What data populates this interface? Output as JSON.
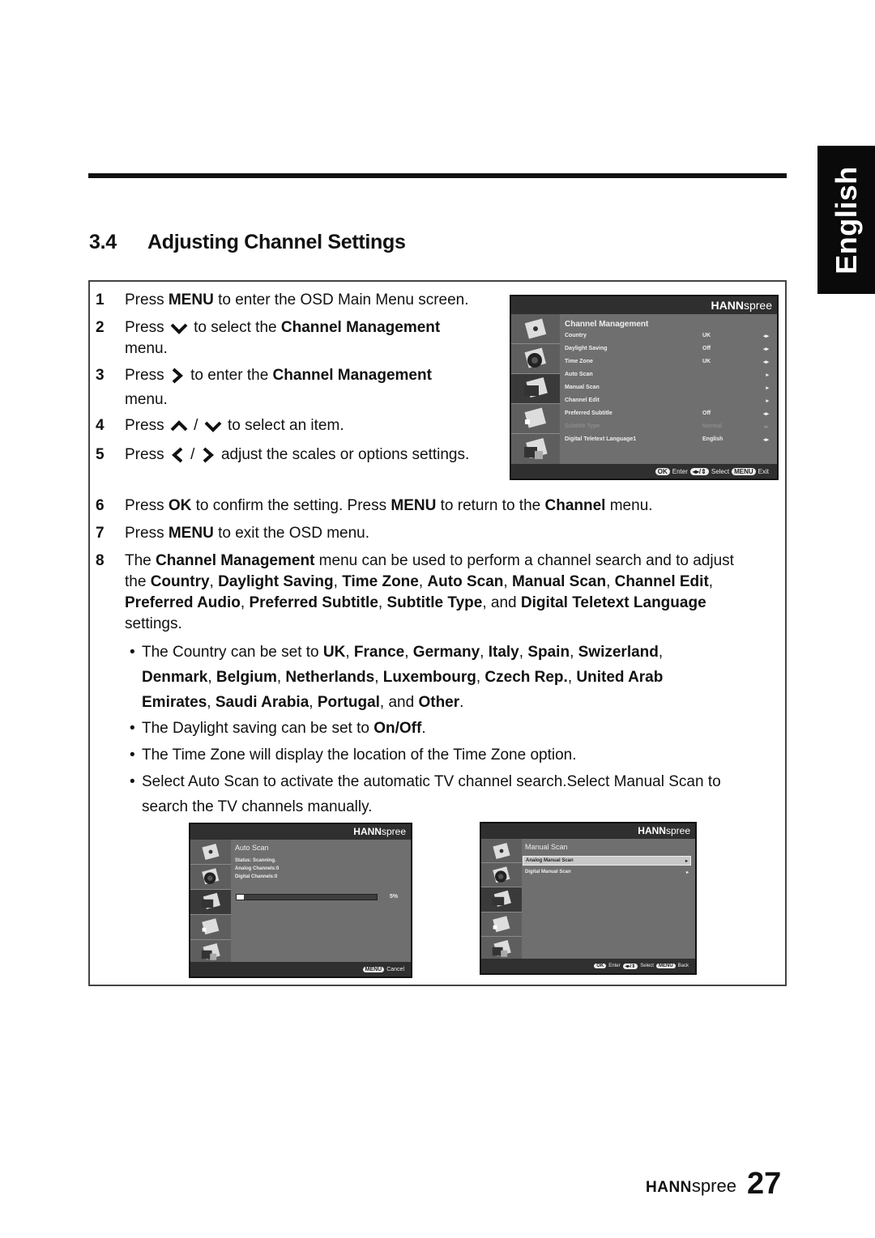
{
  "side_tab": {
    "label": "English"
  },
  "section": {
    "number": "3.4",
    "title": "Adjusting Channel Settings"
  },
  "steps": [
    {
      "n": "1",
      "parts": [
        "Press ",
        "MENU",
        " to enter the OSD Main Menu screen."
      ]
    },
    {
      "n": "2",
      "parts": [
        "Press ",
        " to select the ",
        "Channel Management",
        "menu."
      ],
      "icon": "chevron-down-icon"
    },
    {
      "n": "3",
      "parts": [
        "Press ",
        " to enter the ",
        "Channel Management",
        "menu."
      ],
      "icon": "chevron-right-icon"
    },
    {
      "n": "4",
      "parts": [
        "Press ",
        " / ",
        " to select an item."
      ],
      "icons": [
        "chevron-up-icon",
        "chevron-down-icon"
      ]
    },
    {
      "n": "5",
      "parts": [
        "Press ",
        " / ",
        " adjust the scales or options settings."
      ],
      "icons": [
        "chevron-left-icon",
        "chevron-right-icon"
      ]
    },
    {
      "n": "6",
      "parts": [
        "Press ",
        "OK",
        " to confirm the setting. Press ",
        "MENU",
        " to return to the ",
        "Channel",
        " menu."
      ]
    },
    {
      "n": "7",
      "parts": [
        "Press ",
        "MENU",
        " to exit the OSD menu."
      ]
    },
    {
      "n": "8",
      "parts": [
        "The ",
        "Channel Management",
        " menu can be used to perform a channel search and to adjust",
        "the ",
        "Country",
        ", ",
        "Daylight Saving",
        ", ",
        "Time Zone",
        ", ",
        "Auto Scan",
        ", ",
        "Manual Scan",
        ", ",
        "Channel Edit",
        ",",
        "Preferred Audio",
        ", ",
        "Preferred Subtitle",
        ", ",
        "Subtitle Type",
        ", and ",
        "Digital Teletext Language",
        "settings."
      ]
    }
  ],
  "bullets": [
    {
      "parts": [
        "The Country can be set to ",
        "UK",
        ", ",
        "France",
        ", ",
        "Germany",
        ", ",
        "Italy",
        ", ",
        "Spain",
        ", ",
        "Swizerland",
        ",",
        "Denmark",
        ", ",
        "Belgium",
        ", ",
        "Netherlands",
        ", ",
        "Luxembourg",
        ", ",
        "Czech Rep.",
        ", ",
        "United Arab",
        "Emirates",
        ", ",
        "Saudi Arabia",
        ", ",
        "Portugal",
        ", and ",
        "Other",
        "."
      ]
    },
    {
      "parts": [
        "The Daylight saving can be set to ",
        "On/Off",
        "."
      ]
    },
    {
      "parts": [
        "The Time Zone will display the location of the Time Zone option."
      ]
    },
    {
      "parts": [
        "Select Auto Scan to activate the automatic TV channel search.Select Manual Scan to",
        "search the TV channels manually."
      ]
    }
  ],
  "osd_brand": {
    "bold": "HANN",
    "light": "spree"
  },
  "osd_channel_mgmt": {
    "title": "Channel Management",
    "rows": [
      {
        "label": "Country",
        "value": "UK",
        "arrows": "◂▸",
        "enabled": true
      },
      {
        "label": "Daylight Saving",
        "value": "Off",
        "arrows": "◂▸",
        "enabled": true
      },
      {
        "label": "Time Zone",
        "value": "UK",
        "arrows": "◂▸",
        "enabled": true
      },
      {
        "label": "Auto Scan",
        "value": "",
        "arrows": "▸",
        "enabled": true
      },
      {
        "label": "Manual Scan",
        "value": "",
        "arrows": "▸",
        "enabled": true
      },
      {
        "label": "Channel Edit",
        "value": "",
        "arrows": "▸",
        "enabled": true
      },
      {
        "label": "Preferred Subtitle",
        "value": "Off",
        "arrows": "◂▸",
        "enabled": true
      },
      {
        "label": "Subtitle Type",
        "value": "Normal",
        "arrows": "◂▸",
        "enabled": false
      },
      {
        "label": "Digital Teletext Language1",
        "value": "English",
        "arrows": "◂▸",
        "enabled": true
      }
    ],
    "footer": {
      "ok_key": "OK",
      "enter": "Enter",
      "select_key": "◂▸/⇕",
      "select": "Select",
      "menu_key": "MENU",
      "exit": "Exit"
    }
  },
  "osd_auto_scan": {
    "title": "Auto Scan",
    "status": "Status: Scanning.",
    "analog": "Analog Channels:0",
    "digital": "Digital Channels:0",
    "progress_percent": 5,
    "progress_label": "5%",
    "footer": {
      "menu_key": "MENU",
      "cancel": "Cancel"
    }
  },
  "osd_manual_scan": {
    "title": "Manual Scan",
    "rows": [
      {
        "label": "Analog Manual Scan",
        "selected": true
      },
      {
        "label": "Digital Manual Scan",
        "selected": false
      }
    ],
    "footer": {
      "ok_key": "OK",
      "enter": "Enter",
      "select_key": "◂▸/⇕",
      "select": "Select",
      "menu_key": "MENU",
      "back": "Back"
    }
  },
  "footer": {
    "brand_bold": "HANN",
    "brand_light": "spree",
    "page_number": "27"
  }
}
